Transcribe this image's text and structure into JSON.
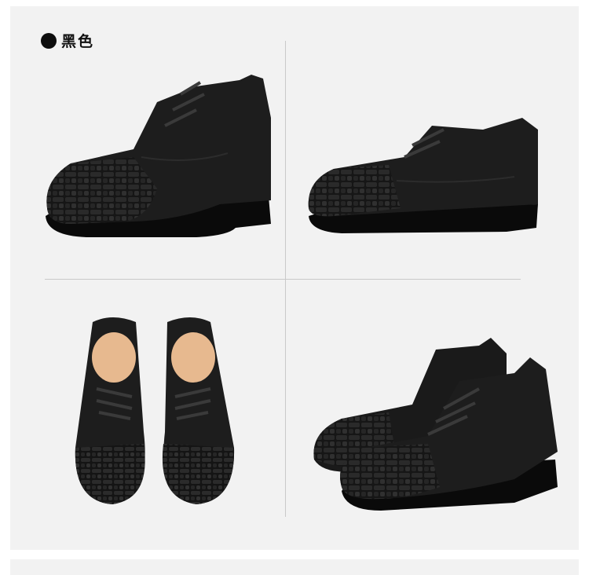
{
  "color_option": {
    "label": "黑色",
    "swatch_color": "#0d0d0d"
  },
  "colors": {
    "panel_bg": "#f2f2f2",
    "divider": "#c9c9c9",
    "leather": "#1b1b1b",
    "sole": "#0a0a0a",
    "insole": "#e7b98f"
  },
  "images": [
    {
      "view": "side-view-left"
    },
    {
      "view": "side-view-right"
    },
    {
      "view": "top-view-pair"
    },
    {
      "view": "three-quarter-pair"
    }
  ]
}
